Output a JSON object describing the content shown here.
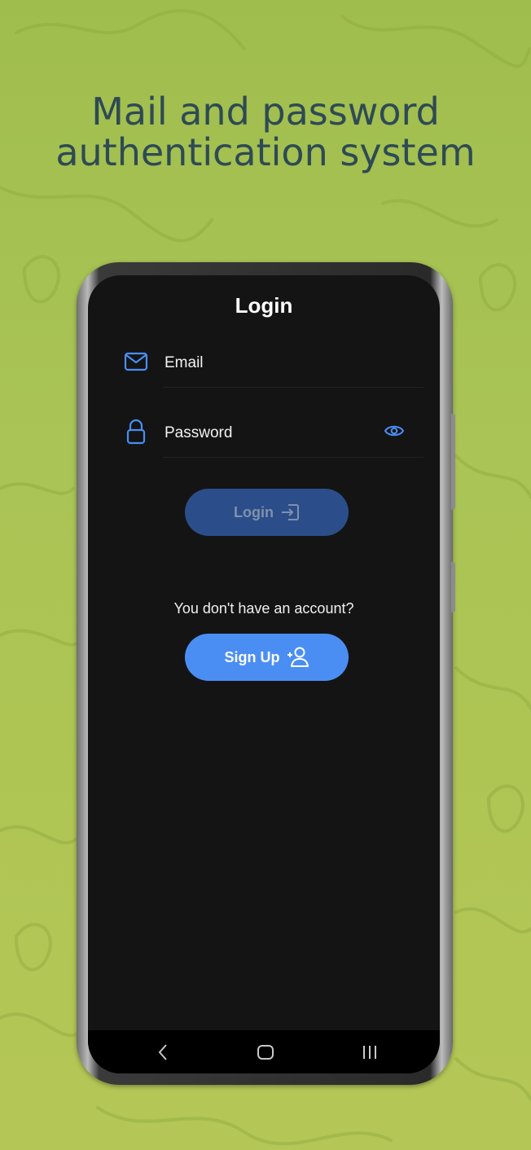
{
  "headline": {
    "line1": "Mail and password",
    "line2": "authentication system"
  },
  "screen": {
    "title": "Login",
    "email_field": {
      "placeholder": "Email",
      "icon": "mail-icon"
    },
    "password_field": {
      "placeholder": "Password",
      "icon": "lock-icon",
      "toggle_icon": "eye-icon"
    },
    "login_button": {
      "label": "Login",
      "icon": "login-arrow-icon"
    },
    "account_prompt": "You don't have an account?",
    "signup_button": {
      "label": "Sign Up",
      "icon": "add-user-icon"
    }
  },
  "navbar": {
    "items": [
      "back-icon",
      "home-icon",
      "recents-icon"
    ]
  },
  "colors": {
    "accent": "#4a8ef4",
    "login_button_disabled": "#2b4e8a",
    "screen_bg": "#141414",
    "headline": "#2e4a55",
    "background": "#a9c04e"
  }
}
